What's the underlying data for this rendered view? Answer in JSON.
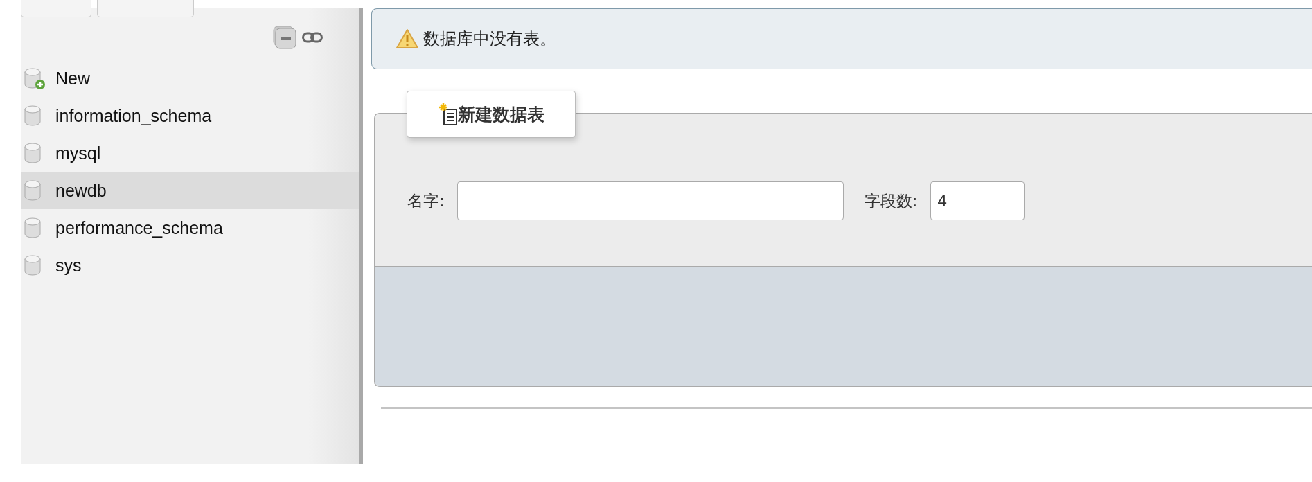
{
  "sidebar": {
    "databases": [
      {
        "name": "New",
        "kind": "new",
        "selected": false
      },
      {
        "name": "information_schema",
        "kind": "db",
        "selected": false
      },
      {
        "name": "mysql",
        "kind": "db",
        "selected": false
      },
      {
        "name": "newdb",
        "kind": "db",
        "selected": true
      },
      {
        "name": "performance_schema",
        "kind": "db",
        "selected": false
      },
      {
        "name": "sys",
        "kind": "db",
        "selected": false
      }
    ]
  },
  "notice": {
    "kind": "warning",
    "text": "数据库中没有表。"
  },
  "create_table": {
    "legend": "新建数据表",
    "fields": [
      {
        "label": "名字:",
        "kind": "wide"
      },
      {
        "label": "字段数:",
        "value": "4",
        "kind": "narrow"
      }
    ]
  }
}
